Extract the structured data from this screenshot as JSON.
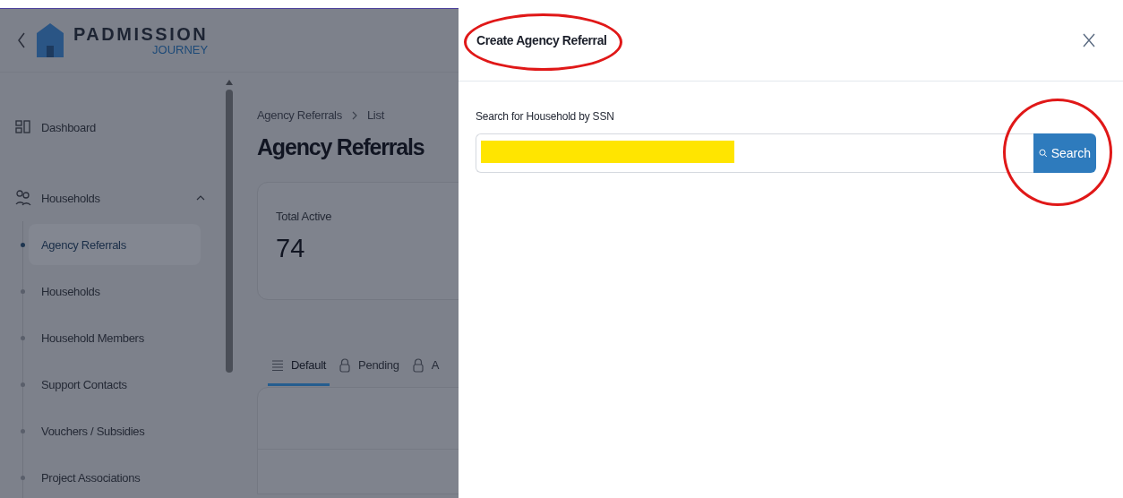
{
  "brand": {
    "name": "PADMISSION",
    "tagline": "JOURNEY"
  },
  "sidebar": {
    "items": [
      {
        "label": "Dashboard",
        "kind": "link"
      },
      {
        "label": "Households",
        "kind": "group",
        "expanded": true,
        "children": [
          {
            "label": "Agency Referrals",
            "selected": true
          },
          {
            "label": "Households",
            "selected": false
          },
          {
            "label": "Household Members",
            "selected": false
          },
          {
            "label": "Support Contacts",
            "selected": false
          },
          {
            "label": "Vouchers / Subsidies",
            "selected": false
          },
          {
            "label": "Project Associations",
            "selected": false
          }
        ]
      }
    ]
  },
  "breadcrumb": [
    "Agency Referrals",
    "List"
  ],
  "page_title": "Agency Referrals",
  "stat_card": {
    "label": "Total Active",
    "value": "74"
  },
  "tabs": [
    {
      "label": "Default",
      "selected": true
    },
    {
      "label": "Pending",
      "selected": false
    },
    {
      "label": "A",
      "selected": false
    }
  ],
  "dialog": {
    "title": "Create Agency Referral",
    "field_label": "Search for Household by SSN",
    "search_button": "Search"
  }
}
